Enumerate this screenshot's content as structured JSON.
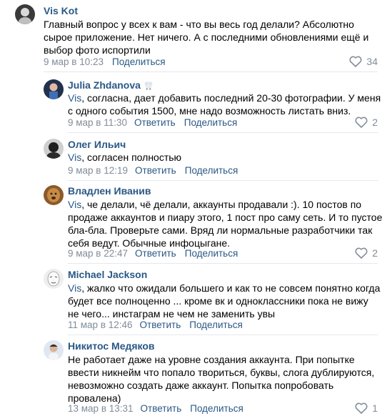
{
  "comments": [
    {
      "author": "Vis Kot",
      "mention": "",
      "text": "Главный вопрос у всех к вам - что вы весь год делали? Абсолютно сырое приложение. Нет ничего. А с последними обновлениями ещё и выбор фото испортили",
      "lines": [
        "Главный вопрос у всех к вам - что вы весь год делали? Абсолютно",
        "сырое приложение. Нет ничего. А с последними обновлениями ещё и",
        "выбор фото испортили"
      ],
      "date": "9 мар в 10:23",
      "reply": "",
      "share": "Поделиться",
      "likes": "34"
    },
    {
      "author": "Julia Zhdanova",
      "mention": "Vis",
      "text": ", согласна, дает добавить последний 20-30 фотографии. У меня с одного события 1500, мне надо возможность листать вниз.",
      "lines": [
        ", согласна, дает добавить последний 20-30 фотографии. У меня",
        "с одного события 1500, мне надо возможность листать вниз."
      ],
      "date": "9 мар в 11:30",
      "reply": "Ответить",
      "share": "Поделиться",
      "likes": "2"
    },
    {
      "author": "Олег Ильич",
      "mention": "Vis",
      "text": ", согласен полностью",
      "lines": [
        ", согласен полностью"
      ],
      "date": "9 мар в 12:19",
      "reply": "Ответить",
      "share": "Поделиться",
      "likes": ""
    },
    {
      "author": "Владлен Иванив",
      "mention": "Vis",
      "text": ", че делали, чё делали, аккаунты продавали :). 10 постов по продаже аккаунтов и пиару этого, 1 пост про саму сеть. И то пустое бла-бла. Проверьте сами. Вряд ли нормальные разработчики так себя ведут. Обычные инфоцыгане.",
      "lines": [
        ", че делали, чё делали, аккаунты продавали :). 10 постов по",
        "продаже аккаунтов и пиару этого, 1 пост про саму сеть. И то пустое",
        "бла-бла. Проверьте сами. Вряд ли нормальные разработчики так",
        "себя ведут. Обычные инфоцыгане."
      ],
      "date": "9 мар в 22:47",
      "reply": "Ответить",
      "share": "Поделиться",
      "likes": "2"
    },
    {
      "author": "Michael Jackson",
      "mention": "Vis",
      "text": ", жалко что ожидали большего и как то не совсем понятно когда будет все полноценно ... кроме вк и одноклассники пока не вижу не чего... инстаграм не чем не заменить увы",
      "lines": [
        ", жалко что ожидали большего и как то не совсем понятно когда",
        "будет все полноценно ... кроме вк и одноклассники пока не вижу",
        "не чего... инстаграм не чем не заменить увы"
      ],
      "date": "11 мар в 12:46",
      "reply": "Ответить",
      "share": "Поделиться",
      "likes": ""
    },
    {
      "author": "Никитос Медяков",
      "mention": "",
      "text": "Не работает даже на уровне создания аккаунта. При попытке ввести никнейм что попало твориться, буквы, слога дублируются, невозможно создать даже аккаунт. Попытка попробовать провалена)",
      "lines": [
        "Не работает даже на уровне создания аккаунта. При попытке",
        "ввести никнейм что попало твориться, буквы, слога дублируются,",
        "невозможно создать даже аккаунт. Попытка попробовать",
        "провалена)"
      ],
      "date": "13 мар в 13:31",
      "reply": "Ответить",
      "share": "Поделиться",
      "likes": "1"
    }
  ]
}
